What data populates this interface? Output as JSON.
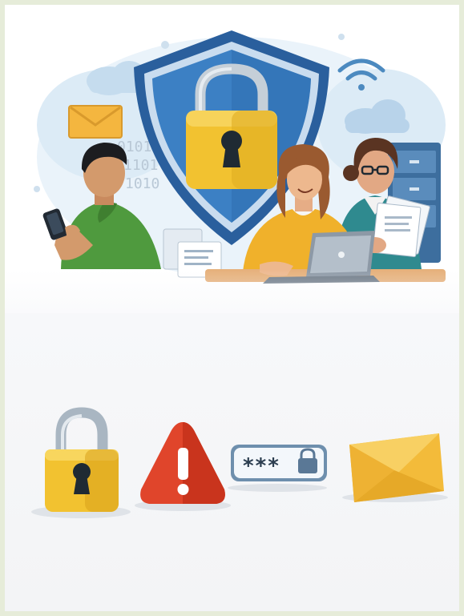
{
  "illustration": {
    "binary_lines": [
      "0101",
      "1101",
      "1010"
    ],
    "password_mask": "***",
    "colors": {
      "shield_outer": "#2f6fb5",
      "shield_inner": "#3f85c8",
      "lock_body": "#f2c230",
      "lock_shackle": "#c9d3dc",
      "warning_red": "#e0452b",
      "envelope": "#f5c242",
      "cloud": "#cfe3f2",
      "person_left_shirt": "#4f9a3e",
      "person_center_shirt": "#f0b12b",
      "person_right_shirt": "#2f8a8f"
    }
  },
  "icons": [
    {
      "name": "padlock-icon"
    },
    {
      "name": "warning-triangle-icon"
    },
    {
      "name": "password-field-icon"
    },
    {
      "name": "envelope-icon"
    }
  ]
}
